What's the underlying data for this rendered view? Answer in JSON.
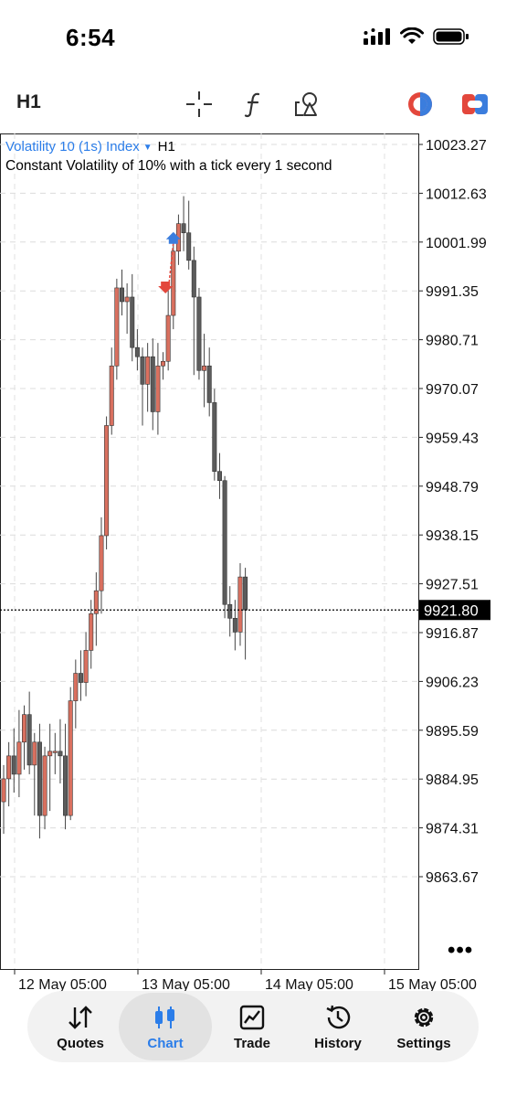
{
  "status_bar": {
    "time": "6:54"
  },
  "toolbar": {
    "timeframe": "H1",
    "tools": [
      "crosshair-icon",
      "indicators-icon",
      "objects-icon",
      "trade-logo-icon",
      "account-icon"
    ]
  },
  "chart": {
    "symbol": "Volatility 10 (1s) Index",
    "symbol_timeframe": "H1",
    "description": "Constant Volatility of 10% with a tick every 1 second",
    "current_price": "9921.80",
    "colors": {
      "bull": "#d9705f",
      "bear": "#5b5b5b",
      "up_arrow": "#3b7ddd",
      "down_arrow": "#e3473c"
    },
    "more": "•••"
  },
  "chart_data": {
    "type": "candlestick",
    "price_ticks": [
      "10023.27",
      "10012.63",
      "10001.99",
      "9991.35",
      "9980.71",
      "9970.07",
      "9959.43",
      "9948.79",
      "9938.15",
      "9927.51",
      "9916.87",
      "9906.23",
      "9895.59",
      "9884.95",
      "9874.31",
      "9863.67"
    ],
    "time_ticks": [
      "12 May 05:00",
      "13 May 05:00",
      "14 May 05:00",
      "15 May 05:00"
    ],
    "current_price": 9921.8,
    "candles": [
      {
        "o": 9880,
        "h": 9888,
        "l": 9873,
        "c": 9885
      },
      {
        "o": 9885,
        "h": 9893,
        "l": 9879,
        "c": 9890
      },
      {
        "o": 9890,
        "h": 9896,
        "l": 9882,
        "c": 9886
      },
      {
        "o": 9886,
        "h": 9900,
        "l": 9881,
        "c": 9893
      },
      {
        "o": 9893,
        "h": 9901,
        "l": 9887,
        "c": 9899
      },
      {
        "o": 9899,
        "h": 9904,
        "l": 9886,
        "c": 9888
      },
      {
        "o": 9888,
        "h": 9895,
        "l": 9877,
        "c": 9893
      },
      {
        "o": 9893,
        "h": 9897,
        "l": 9872,
        "c": 9877
      },
      {
        "o": 9877,
        "h": 9892,
        "l": 9874,
        "c": 9890
      },
      {
        "o": 9890,
        "h": 9897,
        "l": 9878,
        "c": 9891
      },
      {
        "o": 9891,
        "h": 9895,
        "l": 9886,
        "c": 9891
      },
      {
        "o": 9891,
        "h": 9898,
        "l": 9884,
        "c": 9890
      },
      {
        "o": 9890,
        "h": 9897,
        "l": 9874,
        "c": 9877
      },
      {
        "o": 9877,
        "h": 9905,
        "l": 9876,
        "c": 9902
      },
      {
        "o": 9902,
        "h": 9911,
        "l": 9896,
        "c": 9908
      },
      {
        "o": 9908,
        "h": 9913,
        "l": 9902,
        "c": 9906
      },
      {
        "o": 9906,
        "h": 9917,
        "l": 9903,
        "c": 9913
      },
      {
        "o": 9913,
        "h": 9924,
        "l": 9909,
        "c": 9921
      },
      {
        "o": 9921,
        "h": 9930,
        "l": 9914,
        "c": 9926
      },
      {
        "o": 9926,
        "h": 9942,
        "l": 9921,
        "c": 9938
      },
      {
        "o": 9938,
        "h": 9964,
        "l": 9935,
        "c": 9962
      },
      {
        "o": 9962,
        "h": 9979,
        "l": 9960,
        "c": 9975
      },
      {
        "o": 9975,
        "h": 9994,
        "l": 9972,
        "c": 9992
      },
      {
        "o": 9992,
        "h": 9996,
        "l": 9986,
        "c": 9989
      },
      {
        "o": 9989,
        "h": 9993,
        "l": 9982,
        "c": 9990
      },
      {
        "o": 9990,
        "h": 9995,
        "l": 9976,
        "c": 9979
      },
      {
        "o": 9979,
        "h": 9983,
        "l": 9974,
        "c": 9977
      },
      {
        "o": 9977,
        "h": 9979,
        "l": 9962,
        "c": 9971
      },
      {
        "o": 9971,
        "h": 9980,
        "l": 9965,
        "c": 9977
      },
      {
        "o": 9977,
        "h": 9981,
        "l": 9961,
        "c": 9965
      },
      {
        "o": 9965,
        "h": 9980,
        "l": 9960,
        "c": 9975
      },
      {
        "o": 9975,
        "h": 9978,
        "l": 9972,
        "c": 9976
      },
      {
        "o": 9976,
        "h": 9993,
        "l": 9974,
        "c": 9986
      },
      {
        "o": 9986,
        "h": 10003,
        "l": 9983,
        "c": 10000
      },
      {
        "o": 10000,
        "h": 10008,
        "l": 9997,
        "c": 10006
      },
      {
        "o": 10006,
        "h": 10012,
        "l": 10000,
        "c": 10004
      },
      {
        "o": 10004,
        "h": 10011,
        "l": 9996,
        "c": 9998
      },
      {
        "o": 9998,
        "h": 10001,
        "l": 9973,
        "c": 9990
      },
      {
        "o": 9990,
        "h": 9992,
        "l": 9972,
        "c": 9974
      },
      {
        "o": 9974,
        "h": 9982,
        "l": 9966,
        "c": 9975
      },
      {
        "o": 9975,
        "h": 9979,
        "l": 9964,
        "c": 9967
      },
      {
        "o": 9967,
        "h": 9970,
        "l": 9950,
        "c": 9952
      },
      {
        "o": 9952,
        "h": 9956,
        "l": 9946,
        "c": 9950
      },
      {
        "o": 9950,
        "h": 9951,
        "l": 9920,
        "c": 9923
      },
      {
        "o": 9923,
        "h": 9927,
        "l": 9916,
        "c": 9920
      },
      {
        "o": 9920,
        "h": 9924,
        "l": 9913,
        "c": 9917
      },
      {
        "o": 9917,
        "h": 9932,
        "l": 9914,
        "c": 9929
      },
      {
        "o": 9929,
        "h": 9931,
        "l": 9911,
        "c": 9921.8
      }
    ],
    "markers": [
      {
        "type": "sell",
        "candle": 32,
        "price": 9992
      },
      {
        "type": "buy",
        "candle": 33,
        "price": 10003
      }
    ]
  },
  "nav": {
    "items": [
      {
        "label": "Quotes",
        "icon": "quotes-icon"
      },
      {
        "label": "Chart",
        "icon": "chart-icon",
        "active": true
      },
      {
        "label": "Trade",
        "icon": "trade-icon"
      },
      {
        "label": "History",
        "icon": "history-icon"
      },
      {
        "label": "Settings",
        "icon": "settings-icon"
      }
    ]
  }
}
